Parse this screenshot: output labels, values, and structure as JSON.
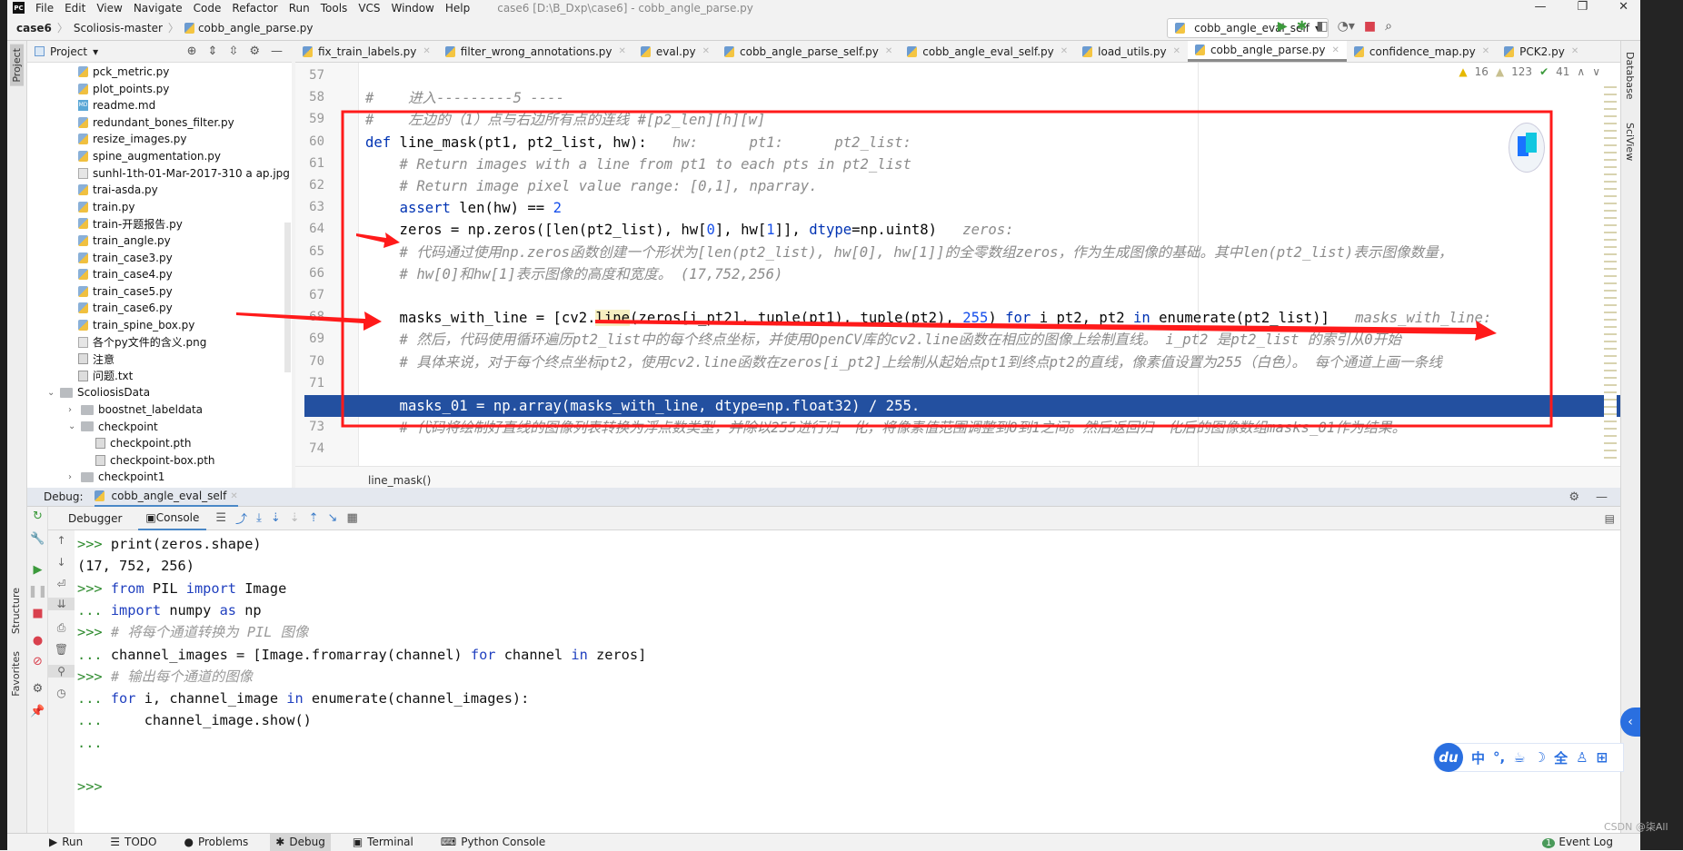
{
  "menu": {
    "items": [
      "File",
      "Edit",
      "View",
      "Navigate",
      "Code",
      "Refactor",
      "Run",
      "Tools",
      "VCS",
      "Window",
      "Help"
    ],
    "title": "case6 [D:\\B_Dxp\\case6] - cobb_angle_parse.py",
    "window_controls": [
      "—",
      "❐",
      "✕"
    ]
  },
  "breadcrumb": [
    "case6",
    "Scoliosis-master",
    "cobb_angle_parse.py"
  ],
  "run_config": {
    "name": "cobb_angle_eval_self",
    "buttons": [
      "run-icon",
      "debug-icon",
      "coverage-icon",
      "profile-icon",
      "stop-icon",
      "search-icon"
    ]
  },
  "project": {
    "title": "Project",
    "items": [
      {
        "label": "pck_metric.py",
        "type": "py",
        "level": 2
      },
      {
        "label": "plot_points.py",
        "type": "py",
        "level": 2
      },
      {
        "label": "readme.md",
        "type": "md",
        "level": 2
      },
      {
        "label": "redundant_bones_filter.py",
        "type": "py",
        "level": 2
      },
      {
        "label": "resize_images.py",
        "type": "py",
        "level": 2
      },
      {
        "label": "spine_augmentation.py",
        "type": "py",
        "level": 2
      },
      {
        "label": "sunhl-1th-01-Mar-2017-310 a ap.jpg",
        "type": "img",
        "level": 2
      },
      {
        "label": "trai-asda.py",
        "type": "py",
        "level": 2
      },
      {
        "label": "train.py",
        "type": "py",
        "level": 2
      },
      {
        "label": "train-开题报告.py",
        "type": "py",
        "level": 2
      },
      {
        "label": "train_angle.py",
        "type": "py",
        "level": 2
      },
      {
        "label": "train_case3.py",
        "type": "py",
        "level": 2
      },
      {
        "label": "train_case4.py",
        "type": "py",
        "level": 2
      },
      {
        "label": "train_case5.py",
        "type": "py",
        "level": 2
      },
      {
        "label": "train_case6.py",
        "type": "py",
        "level": 2
      },
      {
        "label": "train_spine_box.py",
        "type": "py",
        "level": 2
      },
      {
        "label": "各个py文件的含义.png",
        "type": "img",
        "level": 2
      },
      {
        "label": "注意",
        "type": "txt",
        "level": 2
      },
      {
        "label": "问题.txt",
        "type": "txt",
        "level": 2
      },
      {
        "label": "ScoliosisData",
        "type": "folder",
        "level": 0,
        "expanded": true
      },
      {
        "label": "boostnet_labeldata",
        "type": "folder",
        "level": 1,
        "expanded": false
      },
      {
        "label": "checkpoint",
        "type": "folder",
        "level": 1,
        "expanded": true
      },
      {
        "label": "checkpoint.pth",
        "type": "txt",
        "level": 3
      },
      {
        "label": "checkpoint-box.pth",
        "type": "txt",
        "level": 3
      },
      {
        "label": "checkpoint1",
        "type": "folder",
        "level": 1,
        "expanded": false
      }
    ]
  },
  "tabs": [
    {
      "label": "fix_train_labels.py",
      "active": false
    },
    {
      "label": "filter_wrong_annotations.py",
      "active": false
    },
    {
      "label": "eval.py",
      "active": false
    },
    {
      "label": "cobb_angle_parse_self.py",
      "active": false
    },
    {
      "label": "cobb_angle_eval_self.py",
      "active": false
    },
    {
      "label": "load_utils.py",
      "active": false
    },
    {
      "label": "cobb_angle_parse.py",
      "active": true
    },
    {
      "label": "confidence_map.py",
      "active": false
    },
    {
      "label": "PCK2.py",
      "active": false
    }
  ],
  "inspections": {
    "warnings": "16",
    "weak_warnings": "123",
    "typos": "41"
  },
  "right_tools": [
    "Database",
    "SciView"
  ],
  "left_tools": [
    "Project",
    "Structure",
    "Favorites"
  ],
  "code": [
    {
      "n": "57",
      "t": []
    },
    {
      "n": "58",
      "t": [
        [
          "#    进入---------5 ----",
          "cm"
        ]
      ]
    },
    {
      "n": "59",
      "t": [
        [
          "#    左边的（1）点与右边所有点的连线 #[p2_len][h][w]",
          "cm"
        ]
      ]
    },
    {
      "n": "60",
      "t": [
        [
          "def",
          "kw"
        ],
        [
          " line_mask(pt1, pt2_list, hw):",
          ""
        ],
        [
          "   hw:      pt1:      pt2_list:",
          "hint"
        ]
      ]
    },
    {
      "n": "61",
      "t": [
        [
          "    # Return images with a line from pt1 to each pts in pt2_list",
          "cm"
        ]
      ]
    },
    {
      "n": "62",
      "t": [
        [
          "    # Return image pixel value range: [0,1], nparray.",
          "cm"
        ]
      ]
    },
    {
      "n": "63",
      "t": [
        [
          "    ",
          ""
        ],
        [
          "assert",
          "kw"
        ],
        [
          " len(hw) == ",
          ""
        ],
        [
          "2",
          "num"
        ]
      ]
    },
    {
      "n": "64",
      "t": [
        [
          "    zeros = np.zeros([len(pt2_list), hw[",
          ""
        ],
        [
          "0",
          "num"
        ],
        [
          "], hw[",
          ""
        ],
        [
          "1",
          "num"
        ],
        [
          "]], ",
          ""
        ],
        [
          "dtype",
          "kw"
        ],
        [
          "=np.uint8)",
          ""
        ],
        [
          "   zeros:",
          "hint"
        ]
      ]
    },
    {
      "n": "65",
      "t": [
        [
          "    # 代码通过使用np.zeros函数创建一个形状为[len(pt2_list), hw[0], hw[1]]的全零数组zeros，作为生成图像的基础。其中len(pt2_list)表示图像数量，",
          "cm"
        ]
      ]
    },
    {
      "n": "66",
      "t": [
        [
          "    # hw[0]和hw[1]表示图像的高度和宽度。 (17,752,256)",
          "cm"
        ]
      ]
    },
    {
      "n": "67",
      "t": []
    },
    {
      "n": "68",
      "t": [
        [
          "    masks_with_line = [cv2.",
          ""
        ],
        [
          "line",
          "hl"
        ],
        [
          "(zeros[i_pt2], tuple(pt1), tuple(pt2), ",
          ""
        ],
        [
          "255",
          "num"
        ],
        [
          ") ",
          ""
        ],
        [
          "for",
          "kw"
        ],
        [
          " i_pt2, pt2 ",
          ""
        ],
        [
          "in",
          "kw"
        ],
        [
          " enumerate(pt2_list)]",
          ""
        ],
        [
          "   masks_with_line:",
          "hint"
        ]
      ]
    },
    {
      "n": "69",
      "t": [
        [
          "    # 然后，代码使用循环遍历pt2_list中的每个终点坐标，并使用OpenCV库的cv2.line函数在相应的图像上绘制直线。 i_pt2 是pt2_list 的索引从0开始",
          "cm"
        ]
      ]
    },
    {
      "n": "70",
      "t": [
        [
          "    # 具体来说，对于每个终点坐标pt2，使用cv2.line函数在zeros[i_pt2]上绘制从起始点pt1到终点pt2的直线，像素值设置为255（白色）。 每个通道上画一条线",
          "cm"
        ]
      ]
    },
    {
      "n": "71",
      "t": []
    },
    {
      "n": "72",
      "t": [
        [
          "    masks_01 = np.array(masks_with_line, dtype=np.float32) / 255.",
          "white"
        ]
      ],
      "selected": true
    },
    {
      "n": "73",
      "t": [
        [
          "    # 代码将绘制好直线的图像列表转换为浮点数类型，并除以255进行归一化，将像素值范围调整到0到1之间。然后返回归一化后的图像数组masks_01作为结果。",
          "cm"
        ]
      ]
    },
    {
      "n": "74",
      "t": []
    }
  ],
  "editor_breadcrumb": "line_mask()",
  "debug": {
    "label": "Debug:",
    "session": "cobb_angle_eval_self",
    "tabs": [
      {
        "label": "Debugger",
        "active": false
      },
      {
        "label": "Console",
        "active": true
      }
    ]
  },
  "console": [
    [
      [
        ">>> ",
        "pr"
      ],
      [
        "print(zeros.shape)",
        ""
      ]
    ],
    [
      [
        "(17, 752, 256)",
        ""
      ]
    ],
    [
      [
        ">>> ",
        "pr"
      ],
      [
        "from",
        "ckw"
      ],
      [
        " PIL ",
        ""
      ],
      [
        "import",
        "ckw"
      ],
      [
        " Image",
        ""
      ]
    ],
    [
      [
        "... ",
        "pr"
      ],
      [
        "import",
        "ckw"
      ],
      [
        " numpy ",
        ""
      ],
      [
        "as",
        "ckw"
      ],
      [
        " np",
        ""
      ]
    ],
    [
      [
        ">>> ",
        "pr"
      ],
      [
        "# 将每个通道转换为 PIL 图像",
        "ccm"
      ]
    ],
    [
      [
        "... ",
        "pr"
      ],
      [
        "channel_images = [Image.fromarray(channel) ",
        ""
      ],
      [
        "for",
        "ckw"
      ],
      [
        " channel ",
        ""
      ],
      [
        "in",
        "ckw"
      ],
      [
        " zeros]",
        ""
      ]
    ],
    [
      [
        ">>> ",
        "pr"
      ],
      [
        "# 输出每个通道的图像",
        "ccm"
      ]
    ],
    [
      [
        "... ",
        "pr"
      ],
      [
        "for",
        "ckw"
      ],
      [
        " i, channel_image ",
        ""
      ],
      [
        "in",
        "ckw"
      ],
      [
        " enumerate(channel_images):",
        ""
      ]
    ],
    [
      [
        "...     ",
        "pr"
      ],
      [
        "channel_image.show()",
        ""
      ]
    ],
    [
      [
        "...",
        "pr"
      ]
    ],
    [],
    [
      [
        ">>>",
        "pr"
      ]
    ]
  ],
  "statusbar": {
    "items": [
      {
        "label": "Run",
        "icon": "▶"
      },
      {
        "label": "TODO",
        "icon": "☰"
      },
      {
        "label": "Problems",
        "icon": "●"
      },
      {
        "label": "Debug",
        "icon": "✱",
        "active": true
      },
      {
        "label": "Terminal",
        "icon": "▣"
      },
      {
        "label": "Python Console",
        "icon": "⌨"
      }
    ],
    "event_log": "Event Log",
    "event_count": "1"
  },
  "ime": {
    "logo": "du",
    "items": [
      "中",
      "°,",
      "☕",
      "☽",
      "全",
      "♙",
      "⊞"
    ]
  },
  "watermark": "CSDN @柒All",
  "annotation_color": "#ff1a1a"
}
